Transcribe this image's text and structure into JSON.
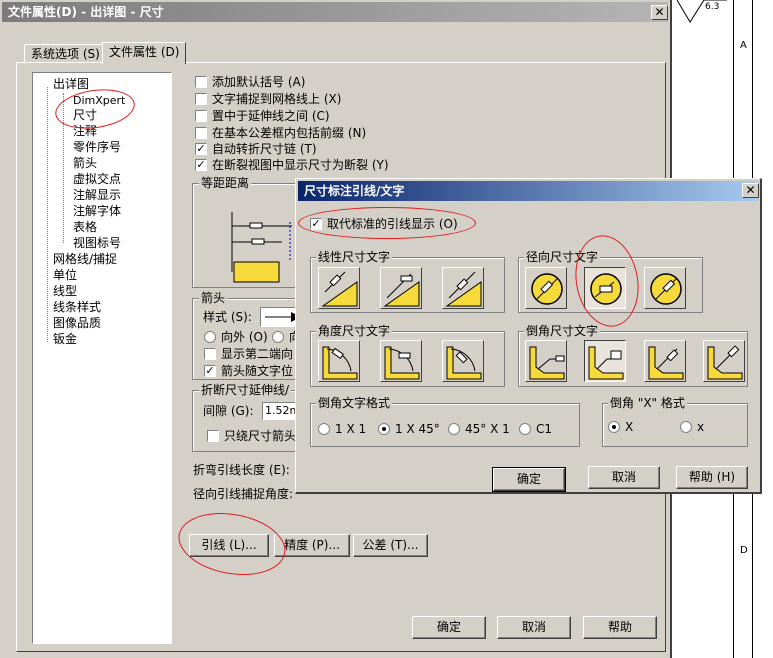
{
  "main_dialog": {
    "title": "文件属性(D) - 出详图 - 尺寸",
    "close_glyph": "✕",
    "tabs": [
      {
        "label": "系统选项 (S)",
        "active": false
      },
      {
        "label": "文件属性 (D)",
        "active": true
      }
    ],
    "tree": [
      {
        "label": "出详图",
        "level": 0
      },
      {
        "label": "DimXpert",
        "level": 1
      },
      {
        "label": "尺寸",
        "level": 1,
        "selected": true
      },
      {
        "label": "注释",
        "level": 1
      },
      {
        "label": "零件序号",
        "level": 1
      },
      {
        "label": "箭头",
        "level": 1
      },
      {
        "label": "虚拟交点",
        "level": 1
      },
      {
        "label": "注解显示",
        "level": 1
      },
      {
        "label": "注解字体",
        "level": 1
      },
      {
        "label": "表格",
        "level": 1
      },
      {
        "label": "视图标号",
        "level": 1
      },
      {
        "label": "网格线/捕捉",
        "level": 0
      },
      {
        "label": "单位",
        "level": 0
      },
      {
        "label": "线型",
        "level": 0
      },
      {
        "label": "线条样式",
        "level": 0
      },
      {
        "label": "图像品质",
        "level": 0
      },
      {
        "label": "钣金",
        "level": 0
      }
    ],
    "options": [
      {
        "label": "添加默认括号 (A)",
        "checked": false
      },
      {
        "label": "文字捕捉到网格线上 (X)",
        "checked": false
      },
      {
        "label": "置中于延伸线之间 (C)",
        "checked": false
      },
      {
        "label": "在基本公差框内包括前缀 (N)",
        "checked": false
      },
      {
        "label": "自动转折尺寸链 (T)",
        "checked": true
      },
      {
        "label": "在断裂视图中显示尺寸为断裂 (Y)",
        "checked": true
      }
    ],
    "offset_group_title": "等距距离",
    "arrow_group": {
      "title": "箭头",
      "style_label": "样式 (S):",
      "radio_outside": "向外 (O)",
      "radio_inside": "向",
      "show_second": "显示第二端向",
      "arrow_follow": "箭头随文字位",
      "arrow_follow_checked": true
    },
    "break_group": {
      "title": "折断尺寸延伸线/",
      "gap_label": "间隙 (G):",
      "gap_value": "1.52m",
      "only_arrow": "只绕尺寸箭头"
    },
    "bent_leader_label": "折弯引线长度 (E):",
    "radial_snap_label": "径向引线捕捉角度:",
    "bottom_buttons": {
      "leader": "引线 (L)...",
      "precision": "精度 (P)...",
      "tolerance": "公差 (T)..."
    },
    "footer_buttons": {
      "ok": "确定",
      "cancel": "取消",
      "help": "帮助"
    }
  },
  "popup": {
    "title": "尺寸标注引线/文字",
    "close_glyph": "✕",
    "modern_leader": {
      "label": "取代标准的引线显示 (O)",
      "checked": true
    },
    "groups": {
      "linear": "线性尺寸文字",
      "radial": "径向尺寸文字",
      "angular": "角度尺寸文字",
      "chamfer": "倒角尺寸文字",
      "chamfer_format": "倒角文字格式",
      "chamfer_x": "倒角 \"X\" 格式"
    },
    "chamfer_format_options": [
      {
        "label": "1 X 1",
        "selected": false
      },
      {
        "label": "1 X 45°",
        "selected": true
      },
      {
        "label": "45° X 1",
        "selected": false
      },
      {
        "label": "C1",
        "selected": false
      }
    ],
    "chamfer_x_options": [
      {
        "label": "X",
        "selected": true
      },
      {
        "label": "x",
        "selected": false
      }
    ],
    "buttons": {
      "ok": "确定",
      "cancel": "取消",
      "help": "帮助 (H)"
    }
  },
  "background": {
    "roughness_label": "6.3",
    "zone_a": "A",
    "zone_d": "D"
  },
  "colors": {
    "dialog_face": "#d4d0c8",
    "active_title": "#0a246a",
    "inactive_title": "#7b7b7b",
    "annotation_red": "#e21b1b",
    "icon_yellow": "#f6d93a"
  }
}
